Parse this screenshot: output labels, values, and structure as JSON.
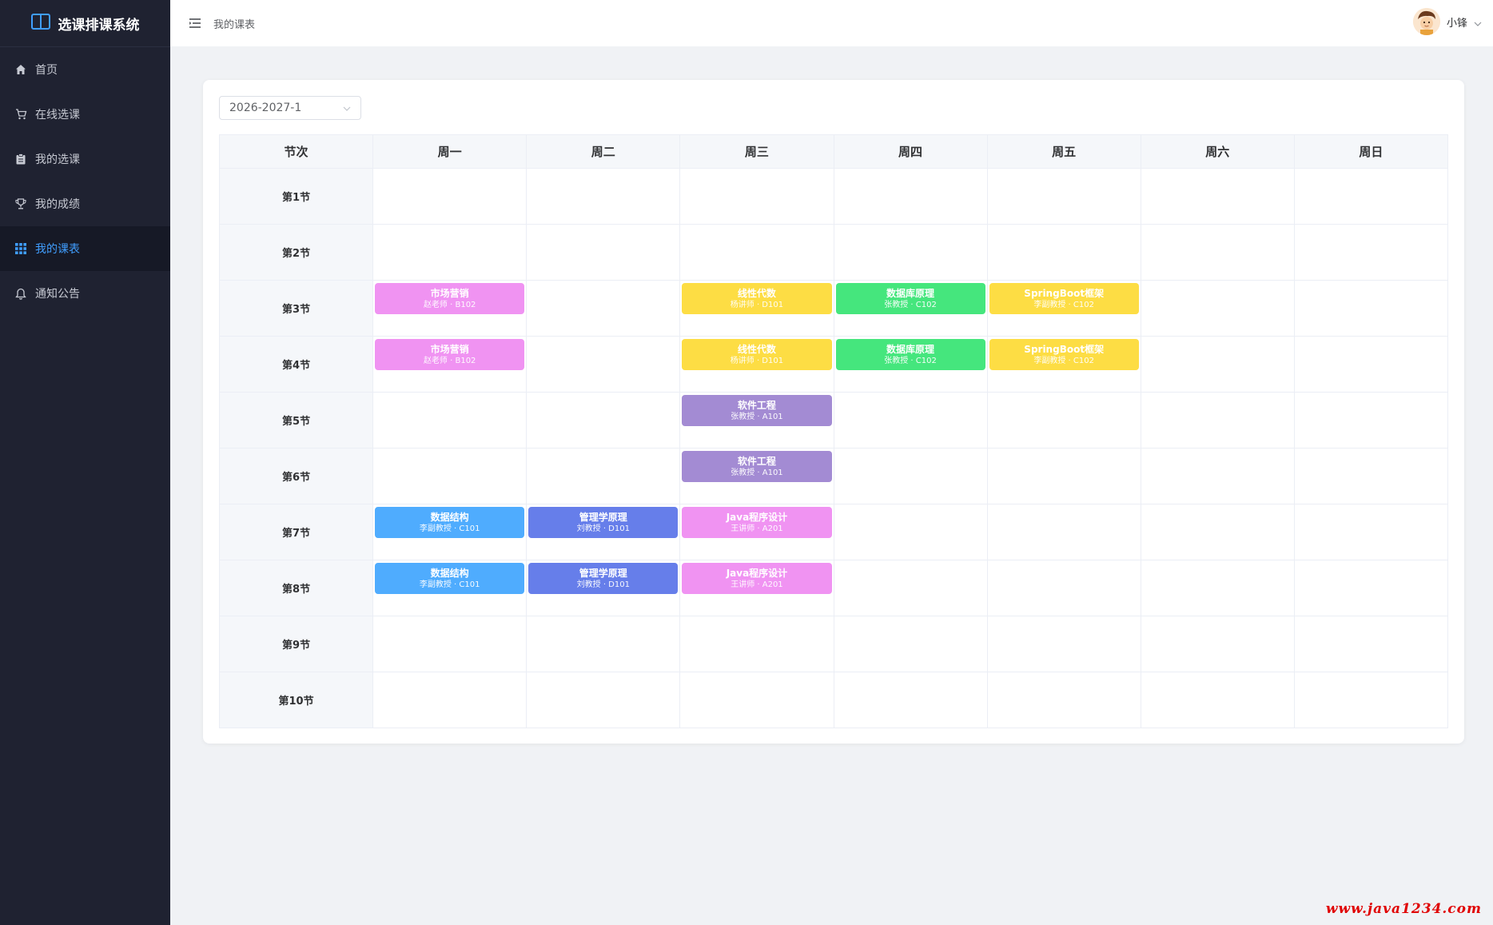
{
  "app": {
    "title": "选课排课系统"
  },
  "sidebar": {
    "items": [
      {
        "label": "首页",
        "icon": "home-icon"
      },
      {
        "label": "在线选课",
        "icon": "cart-icon"
      },
      {
        "label": "我的选课",
        "icon": "clipboard-icon"
      },
      {
        "label": "我的成绩",
        "icon": "trophy-icon"
      },
      {
        "label": "我的课表",
        "icon": "grid-icon",
        "active": true
      },
      {
        "label": "通知公告",
        "icon": "bell-icon"
      }
    ]
  },
  "header": {
    "breadcrumb": "我的课表",
    "username": "小锋"
  },
  "term_select": {
    "value": "2026-2027-1"
  },
  "timetable": {
    "corner_header": "节次",
    "days": [
      "周一",
      "周二",
      "周三",
      "周四",
      "周五",
      "周六",
      "周日"
    ],
    "periods": [
      "第1节",
      "第2节",
      "第3节",
      "第4节",
      "第5节",
      "第6节",
      "第7节",
      "第8节",
      "第9节",
      "第10节"
    ],
    "courses": [
      {
        "period": 3,
        "day": 1,
        "name": "市场营销",
        "detail": "赵老师 · B102",
        "color": "#f093f2"
      },
      {
        "period": 4,
        "day": 1,
        "name": "市场营销",
        "detail": "赵老师 · B102",
        "color": "#f093f2"
      },
      {
        "period": 3,
        "day": 3,
        "name": "线性代数",
        "detail": "杨讲师 · D101",
        "color": "#fddd44"
      },
      {
        "period": 4,
        "day": 3,
        "name": "线性代数",
        "detail": "杨讲师 · D101",
        "color": "#fddd44"
      },
      {
        "period": 3,
        "day": 4,
        "name": "数据库原理",
        "detail": "张教授 · C102",
        "color": "#45e67d"
      },
      {
        "period": 4,
        "day": 4,
        "name": "数据库原理",
        "detail": "张教授 · C102",
        "color": "#45e67d"
      },
      {
        "period": 3,
        "day": 5,
        "name": "SpringBoot框架",
        "detail": "李副教授 · C102",
        "color": "#fddd44"
      },
      {
        "period": 4,
        "day": 5,
        "name": "SpringBoot框架",
        "detail": "李副教授 · C102",
        "color": "#fddd44"
      },
      {
        "period": 5,
        "day": 3,
        "name": "软件工程",
        "detail": "张教授 · A101",
        "color": "#a38bd3"
      },
      {
        "period": 6,
        "day": 3,
        "name": "软件工程",
        "detail": "张教授 · A101",
        "color": "#a38bd3"
      },
      {
        "period": 7,
        "day": 1,
        "name": "数据结构",
        "detail": "李副教授 · C101",
        "color": "#4facfe"
      },
      {
        "period": 8,
        "day": 1,
        "name": "数据结构",
        "detail": "李副教授 · C101",
        "color": "#4facfe"
      },
      {
        "period": 7,
        "day": 2,
        "name": "管理学原理",
        "detail": "刘教授 · D101",
        "color": "#667eea"
      },
      {
        "period": 8,
        "day": 2,
        "name": "管理学原理",
        "detail": "刘教授 · D101",
        "color": "#667eea"
      },
      {
        "period": 7,
        "day": 3,
        "name": "Java程序设计",
        "detail": "王讲师 · A201",
        "color": "#f093f2"
      },
      {
        "period": 8,
        "day": 3,
        "name": "Java程序设计",
        "detail": "王讲师 · A201",
        "color": "#f093f2"
      }
    ]
  },
  "watermark": "www.java1234.com",
  "colors": {
    "sidebar_bg": "#1f2231",
    "accent": "#409eff"
  }
}
